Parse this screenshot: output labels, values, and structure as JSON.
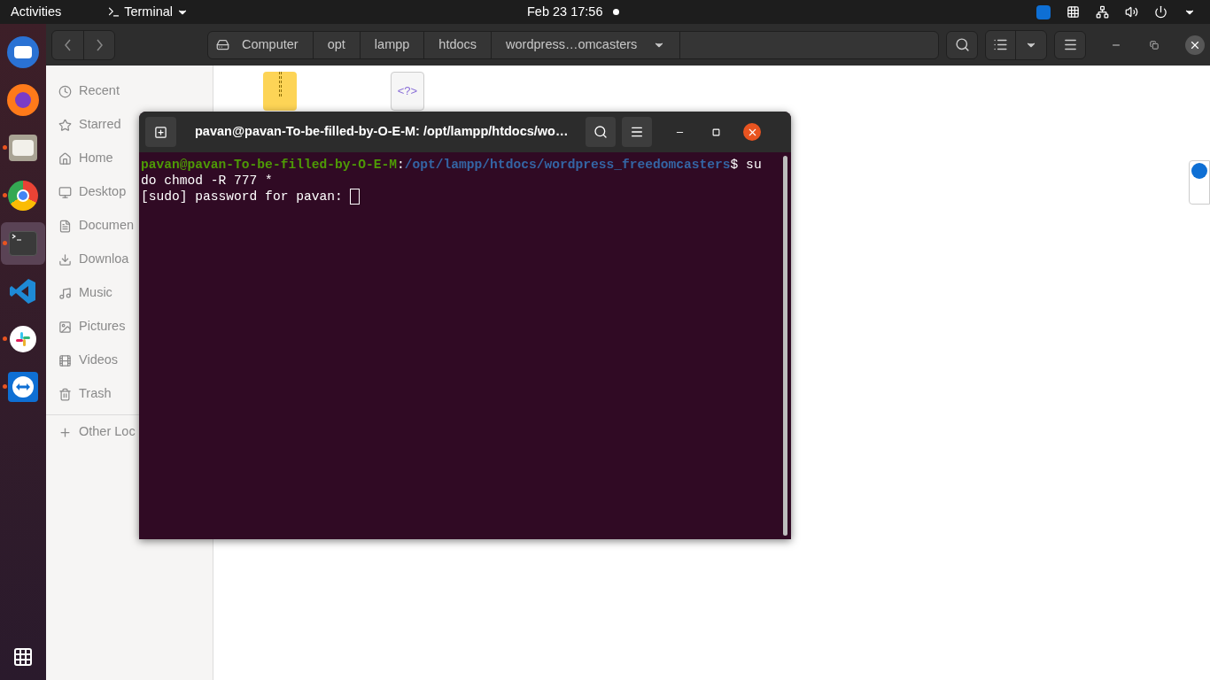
{
  "top_bar": {
    "activities": "Activities",
    "app_menu": "Terminal",
    "clock": "Feb 23  17:56"
  },
  "dock": {
    "items": [
      {
        "kind": "mail",
        "running": false,
        "selected": false
      },
      {
        "kind": "browser-fox",
        "running": false,
        "selected": false
      },
      {
        "kind": "folder",
        "running": true,
        "selected": false
      },
      {
        "kind": "browser-circle",
        "running": true,
        "selected": false
      },
      {
        "kind": "terminal",
        "running": true,
        "selected": true
      },
      {
        "kind": "code",
        "running": false,
        "selected": false
      },
      {
        "kind": "chat",
        "running": true,
        "selected": false
      },
      {
        "kind": "remote",
        "running": true,
        "selected": false
      }
    ]
  },
  "file_manager": {
    "path": [
      "Computer",
      "opt",
      "lampp",
      "htdocs",
      "wordpress…omcasters"
    ],
    "sidebar": {
      "items": [
        {
          "kind": "clock",
          "label": "Recent",
          "selected": false
        },
        {
          "kind": "star",
          "label": "Starred",
          "selected": false
        },
        {
          "kind": "home",
          "label": "Home",
          "selected": false
        },
        {
          "kind": "desktop",
          "label": "Desktop",
          "selected": false
        },
        {
          "kind": "doc",
          "label": "Documen",
          "selected": false
        },
        {
          "kind": "download",
          "label": "Downloa",
          "selected": false
        },
        {
          "kind": "music",
          "label": "Music",
          "selected": false
        },
        {
          "kind": "image",
          "label": "Pictures",
          "selected": false
        },
        {
          "kind": "film",
          "label": "Videos",
          "selected": false
        },
        {
          "kind": "trash",
          "label": "Trash",
          "selected": false
        }
      ],
      "other": "Other Loc"
    },
    "files": [
      {
        "kind": "zip"
      },
      {
        "kind": "php",
        "glyph": "<?>"
      }
    ]
  },
  "terminal": {
    "title": "pavan@pavan-To-be-filled-by-O-E-M: /opt/lampp/htdocs/wo…",
    "lines": [
      [
        {
          "kind": "user",
          "text": "pavan@pavan-To-be-filled-by-O-E-M"
        },
        {
          "kind": "plain",
          "text": ":"
        },
        {
          "kind": "path",
          "text": "/opt/lampp/htdocs/wordpress_freedomcasters"
        },
        {
          "kind": "plain",
          "text": "$ su"
        }
      ],
      [
        {
          "kind": "plain",
          "text": "do chmod -R 777 *"
        }
      ],
      [
        {
          "kind": "plain",
          "text": "[sudo] password for pavan: "
        },
        {
          "kind": "cursor"
        }
      ]
    ]
  }
}
